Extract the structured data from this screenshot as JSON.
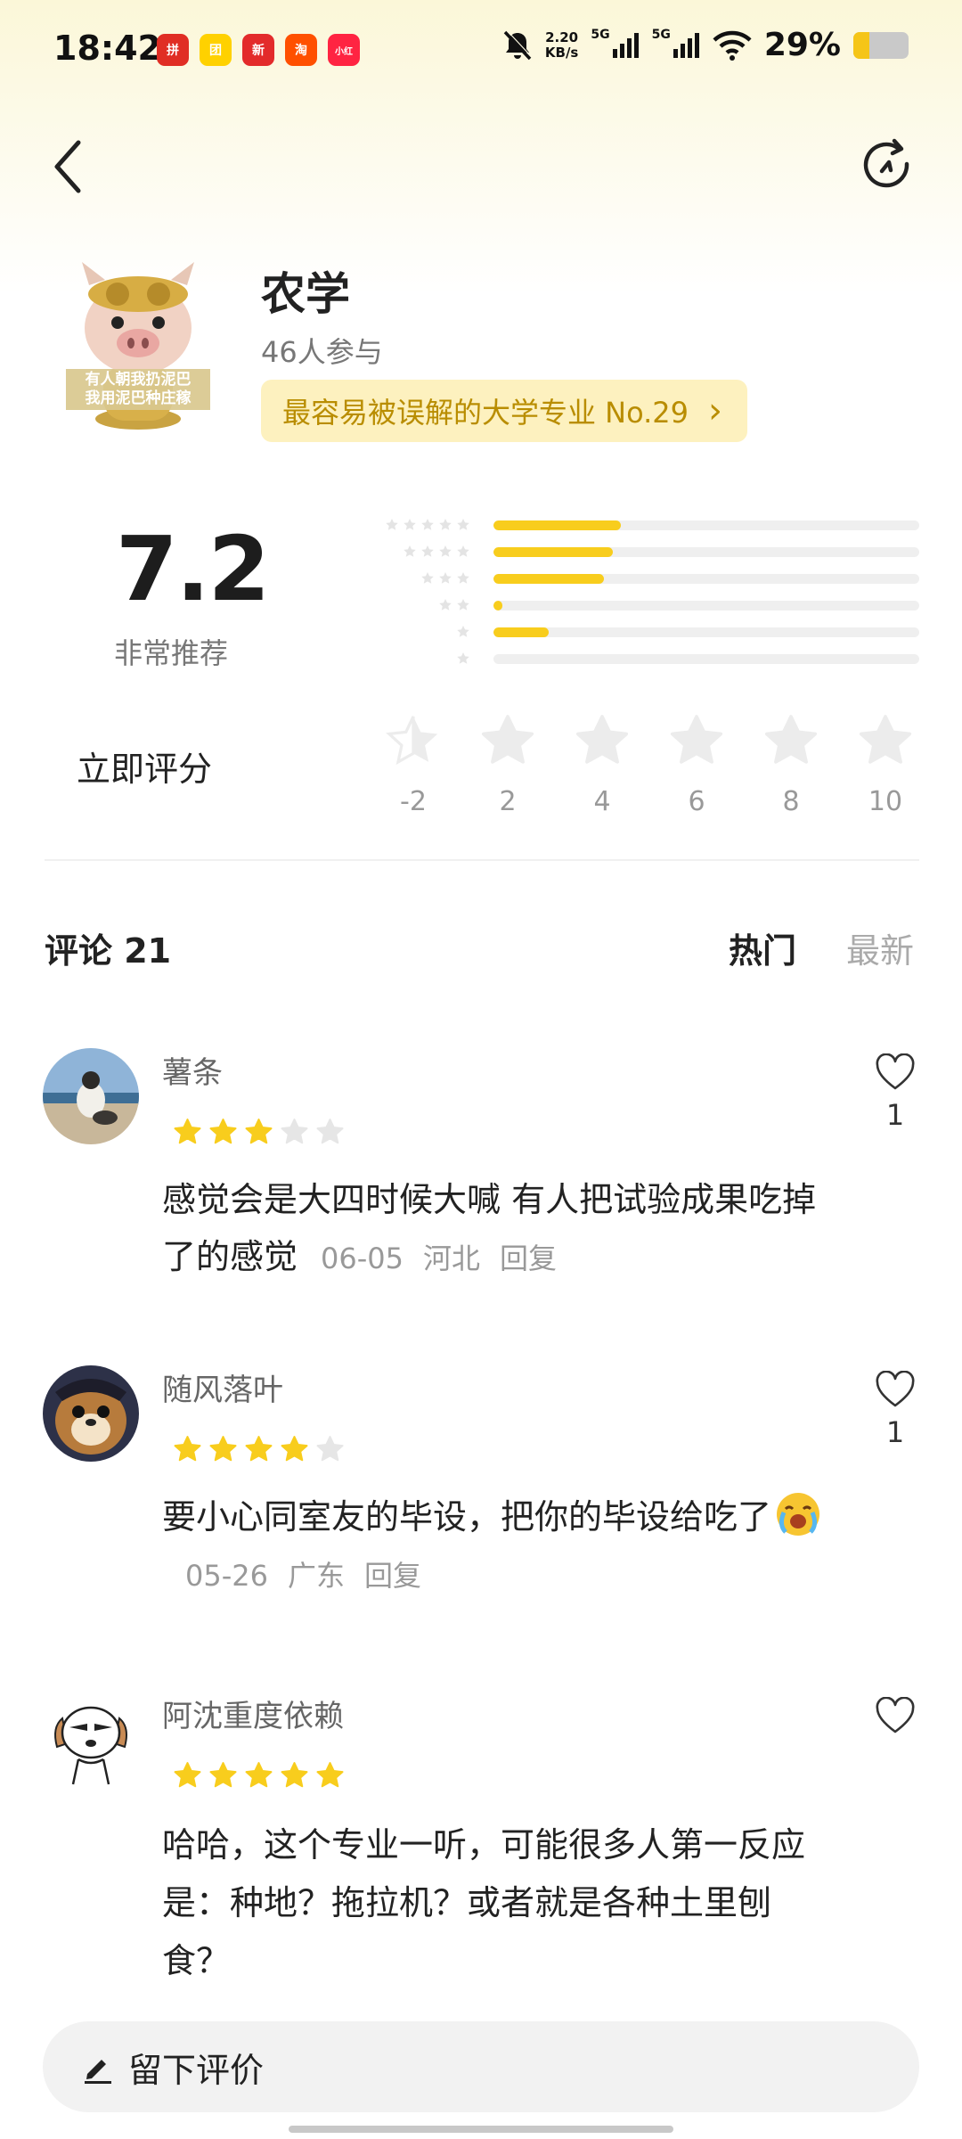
{
  "status_bar": {
    "time": "18:42",
    "apps": [
      {
        "name": "pinduoduo-icon",
        "label": "拼",
        "color": "#e02e24"
      },
      {
        "name": "meituan-icon",
        "label": "团",
        "color": "#ffd100"
      },
      {
        "name": "news-icon",
        "label": "新",
        "color": "#e32b2b"
      },
      {
        "name": "taobao-icon",
        "label": "淘",
        "color": "#ff5000"
      },
      {
        "name": "xiaohongshu-icon",
        "label": "小红书",
        "color": "#ff2442"
      }
    ],
    "speed_value": "2.20",
    "speed_unit": "KB/s",
    "network_1": "5G",
    "network_2": "5G",
    "battery_text": "29%",
    "battery_level": 0.29
  },
  "header": {
    "back_icon": "chevron-left-icon",
    "refresh_icon": "refresh-icon"
  },
  "topic": {
    "cover_text_line1": "有人朝我扔泥巴",
    "cover_text_line2": "我用泥巴种庄稼",
    "title": "农学",
    "participants": "46人参与",
    "rank_label": "最容易被误解的大学专业 No.29",
    "rank_arrow": "›"
  },
  "rating": {
    "score": "7.2",
    "description": "非常推荐",
    "distribution": [
      {
        "stars": 5,
        "fraction": 0.3
      },
      {
        "stars": 4,
        "fraction": 0.28
      },
      {
        "stars": 3,
        "fraction": 0.26
      },
      {
        "stars": 2,
        "fraction": 0.02
      },
      {
        "stars": 1,
        "fraction": 0.13
      },
      {
        "stars": 0,
        "fraction": 0.0
      }
    ],
    "rate_now_label": "立即评分",
    "rate_options": [
      "-2",
      "2",
      "4",
      "6",
      "8",
      "10"
    ]
  },
  "comments_section": {
    "title": "评论 21",
    "sort_hot": "热门",
    "sort_new": "最新"
  },
  "comments": [
    {
      "name": "薯条",
      "stars": 3,
      "text": "感觉会是大四时候大喊 有人把试验成果吃掉了的感觉",
      "date": "06-05",
      "location": "河北",
      "reply": "回复",
      "likes": "1"
    },
    {
      "name": "随风落叶",
      "stars": 4,
      "text": "要小心同室友的毕设，把你的毕设给吃了",
      "date": "05-26",
      "location": "广东",
      "reply": "回复",
      "likes": "1"
    },
    {
      "name": "阿沈重度依赖",
      "stars": 5,
      "text": "哈哈，这个专业一听，可能很多人第一反应是：种地？拖拉机？或者就是各种土里刨食？",
      "likes": ""
    }
  ],
  "bottom_bar": {
    "label": "留下评价"
  },
  "colors": {
    "accent_star": "#f8cd1d",
    "rank_text": "#b98d00",
    "rank_bg": "#fdf1bf"
  }
}
